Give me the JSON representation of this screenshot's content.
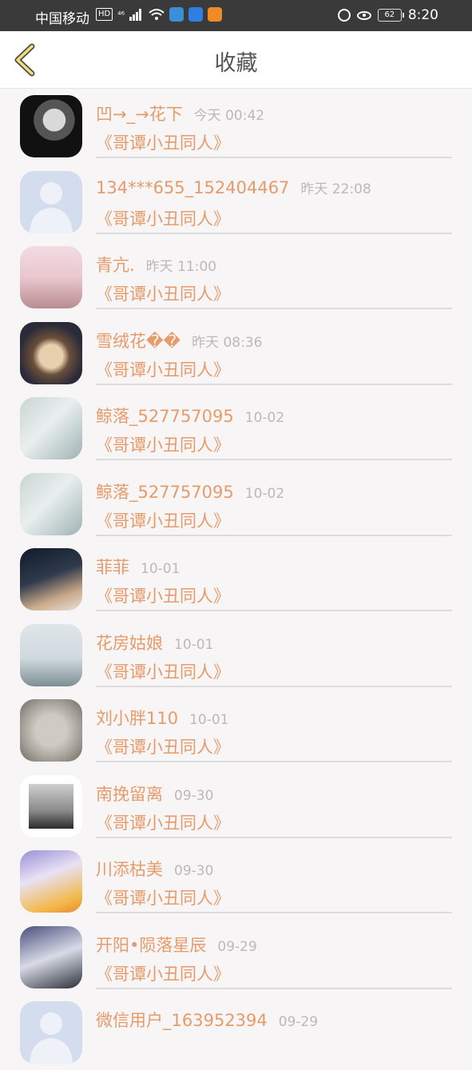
{
  "statusbar": {
    "carrier": "中国移动",
    "hd_badge": "HD",
    "net_badge": "⁴⁶",
    "battery": "62",
    "time": "8:20"
  },
  "header": {
    "title": "收藏"
  },
  "items": [
    {
      "name": "凹→_→花下",
      "time": "今天 00:42",
      "sub": "《哥谭小丑同人》"
    },
    {
      "name": "134***655_152404467",
      "time": "昨天 22:08",
      "sub": "《哥谭小丑同人》"
    },
    {
      "name": "青亢.",
      "time": "昨天 11:00",
      "sub": "《哥谭小丑同人》"
    },
    {
      "name": "雪绒花��",
      "time": "昨天 08:36",
      "sub": "《哥谭小丑同人》"
    },
    {
      "name": "鲸落_527757095",
      "time": "10-02",
      "sub": "《哥谭小丑同人》"
    },
    {
      "name": "鲸落_527757095",
      "time": "10-02",
      "sub": "《哥谭小丑同人》"
    },
    {
      "name": "菲菲",
      "time": "10-01",
      "sub": "《哥谭小丑同人》"
    },
    {
      "name": "花房姑娘",
      "time": "10-01",
      "sub": "《哥谭小丑同人》"
    },
    {
      "name": "刘小胖110",
      "time": "10-01",
      "sub": "《哥谭小丑同人》"
    },
    {
      "name": "南挽留离",
      "time": "09-30",
      "sub": "《哥谭小丑同人》"
    },
    {
      "name": "川添枯美",
      "time": "09-30",
      "sub": "《哥谭小丑同人》"
    },
    {
      "name": "开阳•陨落星辰",
      "time": "09-29",
      "sub": "《哥谭小丑同人》"
    },
    {
      "name": "微信用户_163952394",
      "time": "09-29",
      "sub": ""
    }
  ]
}
